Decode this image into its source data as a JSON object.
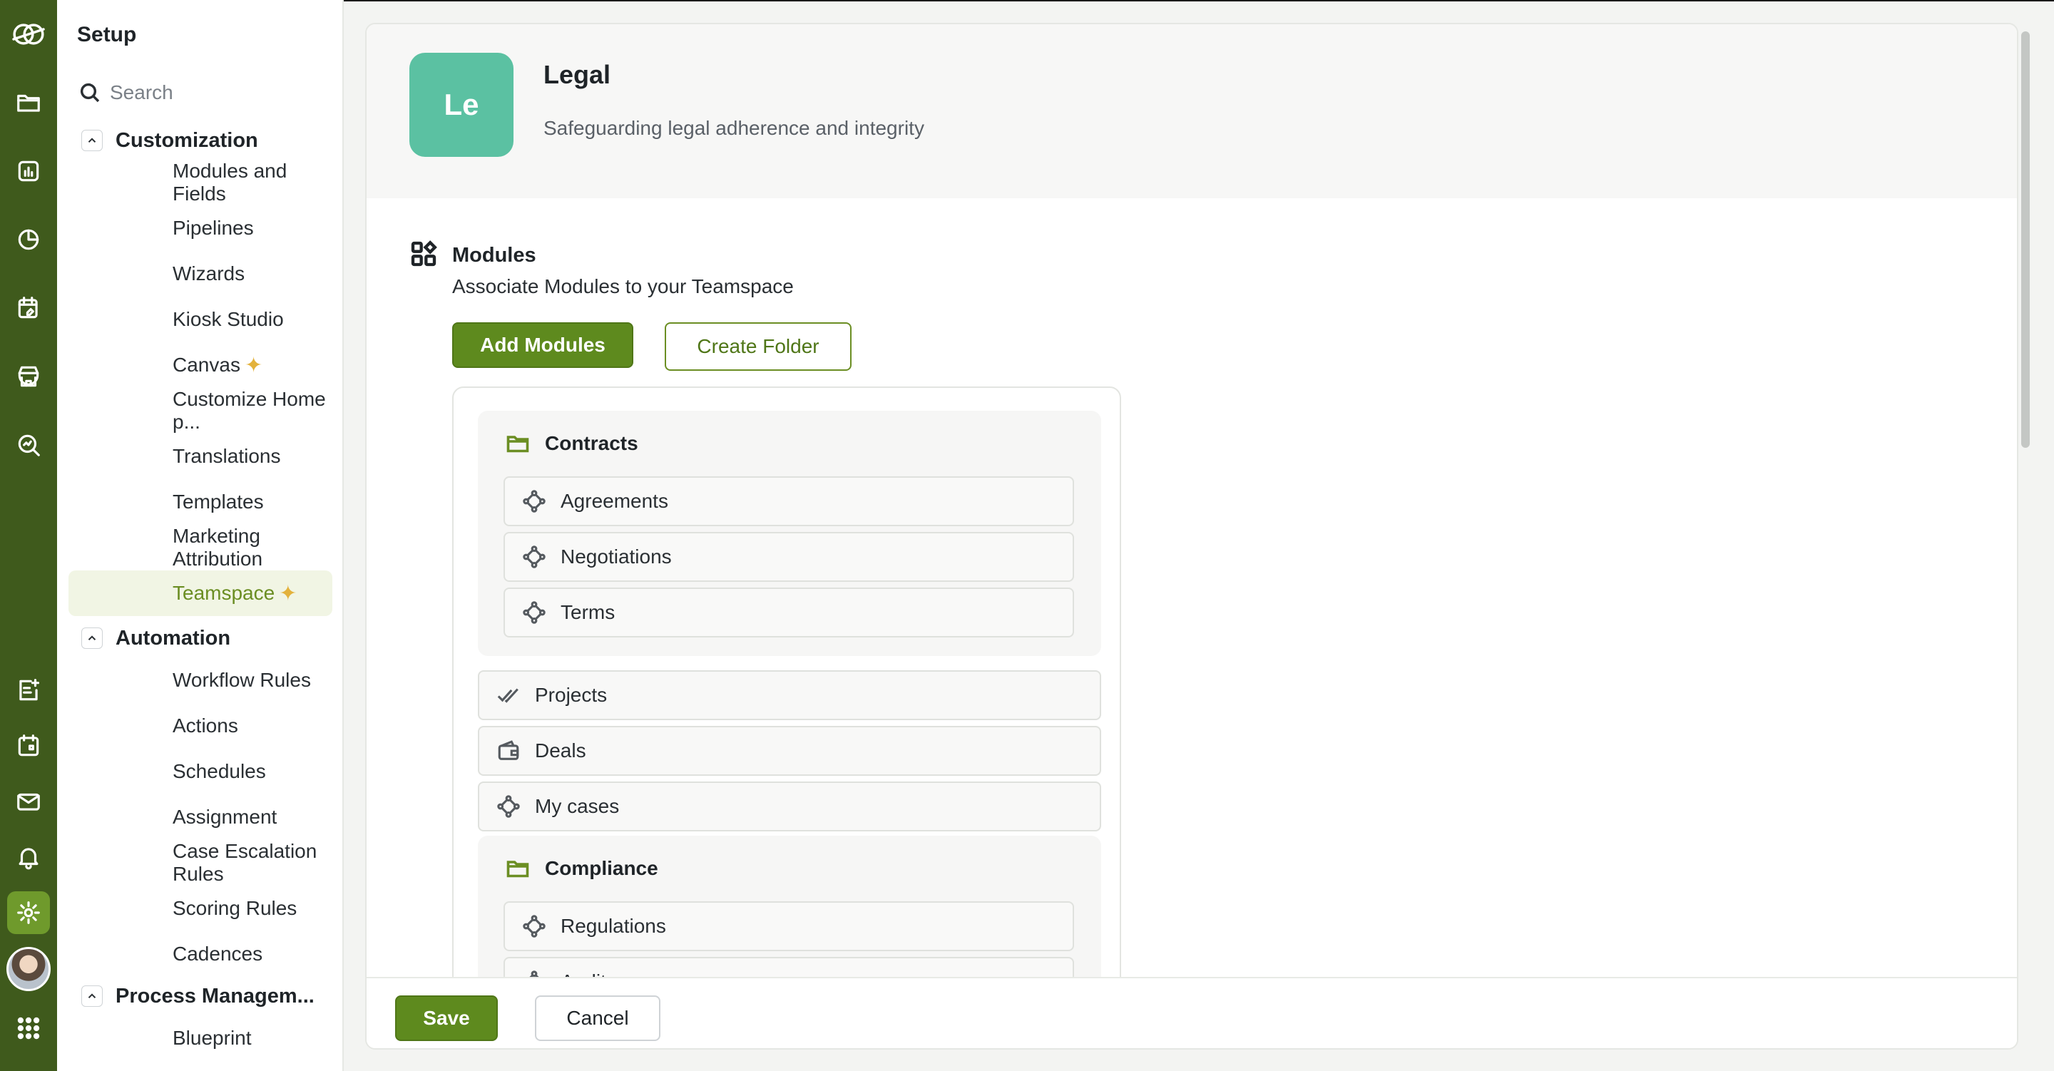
{
  "sidebar": {
    "title": "Setup",
    "search_placeholder": "Search",
    "sections": [
      {
        "label": "Customization",
        "items": [
          {
            "label": "Modules and Fields"
          },
          {
            "label": "Pipelines"
          },
          {
            "label": "Wizards"
          },
          {
            "label": "Kiosk Studio"
          },
          {
            "label": "Canvas",
            "sparkle": true
          },
          {
            "label": "Customize Home p..."
          },
          {
            "label": "Translations"
          },
          {
            "label": "Templates"
          },
          {
            "label": "Marketing Attribution"
          },
          {
            "label": "Teamspace",
            "sparkle": true,
            "active": true
          }
        ]
      },
      {
        "label": "Automation",
        "items": [
          {
            "label": "Workflow Rules"
          },
          {
            "label": "Actions"
          },
          {
            "label": "Schedules"
          },
          {
            "label": "Assignment"
          },
          {
            "label": "Case Escalation Rules"
          },
          {
            "label": "Scoring Rules"
          },
          {
            "label": "Cadences"
          }
        ]
      },
      {
        "label": "Process Managem...",
        "items": [
          {
            "label": "Blueprint"
          }
        ]
      }
    ]
  },
  "rail": {
    "top_icons": [
      "logo-icon",
      "folder-icon",
      "report-icon",
      "analytics-icon",
      "planner-icon",
      "marketplace-icon",
      "search-analytics-icon"
    ],
    "bottom_icons": [
      "add-note-icon",
      "calendar-icon",
      "mail-icon",
      "bell-icon",
      "gear-icon"
    ],
    "active": "gear-icon"
  },
  "teamspace": {
    "badge": "Le",
    "badge_color": "#5bc1a2",
    "name": "Legal",
    "description": "Safeguarding legal adherence and integrity"
  },
  "modules": {
    "title": "Modules",
    "subtitle": "Associate Modules to your Teamspace",
    "add_button": "Add Modules",
    "create_folder_button": "Create Folder",
    "folders": [
      {
        "name": "Contracts",
        "items": [
          "Agreements",
          "Negotiations",
          "Terms"
        ]
      },
      {
        "name": "Compliance",
        "items": [
          "Regulations",
          "Audits"
        ]
      }
    ],
    "loose": [
      {
        "label": "Projects",
        "icon": "double-check-icon"
      },
      {
        "label": "Deals",
        "icon": "wallet-icon"
      },
      {
        "label": "My cases",
        "icon": "module-icon"
      }
    ]
  },
  "footer": {
    "save": "Save",
    "cancel": "Cancel"
  },
  "colors": {
    "rail": "#3f5a1c",
    "accent": "#5e8a1e",
    "active_item_bg": "#f1f5e4"
  }
}
